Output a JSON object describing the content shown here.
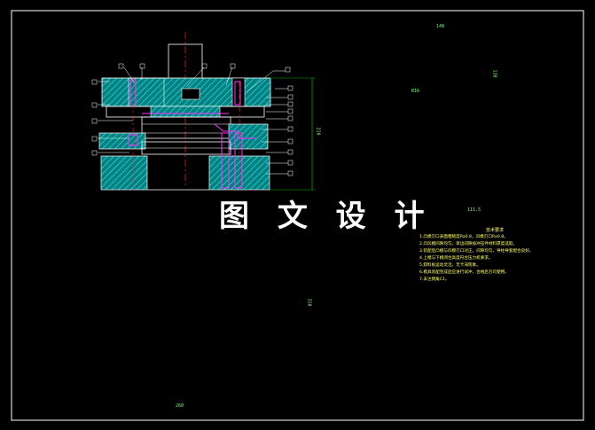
{
  "watermark": "图 文 设 计",
  "dims": {
    "total_width": "260",
    "total_height": "210",
    "plate_length": "318",
    "blank_width": "148",
    "blank_height": "138",
    "strip_pitch": "111.5",
    "corner_radius": "R16"
  },
  "tech_notes": {
    "title": "技术要求",
    "lines": [
      "1.凸模刃口表面粗糙度Ra0.8，凹模刃口Ra0.8。",
      "2.凸凹模间隙均匀，单边间隙按冲压件材料厚度选取。",
      "3.装配后凸模与凹模刃口对正，间隙均匀，导柱导套配合良好。",
      "4.上模与下模闭合高度符合压力机要求。",
      "5.卸料板运动灵活，无卡滞现象。",
      "6.模具装配完成后应进行试冲，合格后方可使用。",
      "7.未注倒角C1。"
    ]
  },
  "colors": {
    "background": "#000000",
    "line": "#ffffff",
    "hatch": "#00c8c8",
    "center": "#ff2020",
    "dimension": "#00e000",
    "highlight": "#ff33ff",
    "outline": "#ffff44"
  }
}
